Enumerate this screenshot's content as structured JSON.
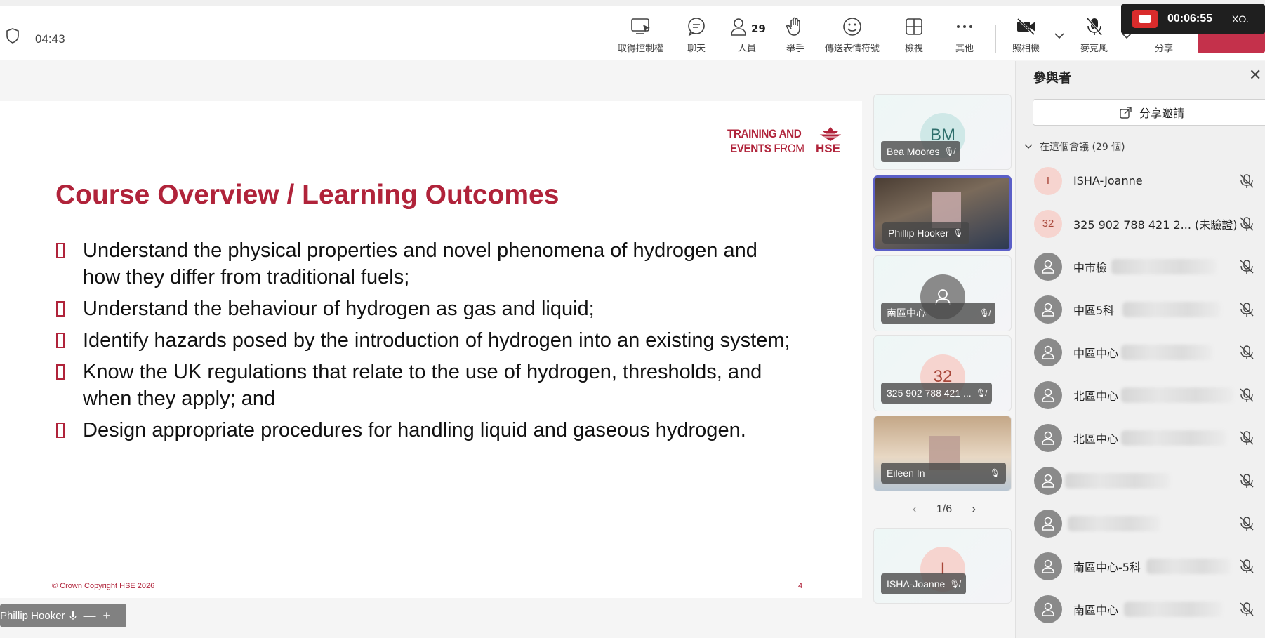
{
  "topbar": {
    "elapsed": "04:43",
    "buttons": {
      "control": "取得控制權",
      "chat": "聊天",
      "people": "人員",
      "people_count": "29",
      "raise": "舉手",
      "react": "傳送表情符號",
      "view": "檢視",
      "more": "其他",
      "camera": "照相機",
      "mic": "麥克風",
      "share": "分享"
    },
    "recording_time": "00:06:55",
    "recording_extra": "XO."
  },
  "slide": {
    "brand_line1": "TRAINING AND",
    "brand_line2_bold": "EVENTS",
    "brand_line2_light": " FROM",
    "brand_hse": "HSE",
    "title": "Course Overview / Learning Outcomes",
    "bullets": [
      "Understand the physical properties and novel phenomena of hydrogen and how they differ from traditional fuels;",
      "Understand the behaviour of hydrogen as gas and liquid;",
      "Identify hazards posed by the introduction of hydrogen into an existing system;",
      "Know the UK regulations that relate to the use of hydrogen, thresholds, and when they apply; and",
      "Design appropriate procedures for handling liquid and gaseous hydrogen."
    ],
    "copyright": "© Crown Copyright HSE 2026",
    "page": "4"
  },
  "pip": {
    "name": "Phillip Hooker"
  },
  "tiles": [
    {
      "initials": "BM",
      "name": "Bea Moores"
    },
    {
      "initials": "",
      "name": "Phillip Hooker"
    },
    {
      "initials": "",
      "name": "南區中心"
    },
    {
      "initials": "32",
      "name": "325 902 788 421 ..."
    },
    {
      "initials": "",
      "name": "Eileen In"
    },
    {
      "initials": "I",
      "name": "ISHA-Joanne"
    }
  ],
  "pager": {
    "label": "1/6"
  },
  "panel": {
    "title": "參與者",
    "share_label": "分享邀請",
    "section_label": "在這個會議 (29 個)",
    "participants": [
      {
        "initial": "I",
        "name": "ISHA-Joanne"
      },
      {
        "initial": "32",
        "name": "325 902 788 421 2... (未驗證)"
      },
      {
        "initial": "",
        "name": "中市檢"
      },
      {
        "initial": "",
        "name": "中區5科"
      },
      {
        "initial": "",
        "name": "中區中心"
      },
      {
        "initial": "",
        "name": "北區中心"
      },
      {
        "initial": "",
        "name": "北區中心"
      },
      {
        "initial": "",
        "name": ""
      },
      {
        "initial": "",
        "name": ""
      },
      {
        "initial": "",
        "name": "南區中心-5科"
      },
      {
        "initial": "",
        "name": "南區中心"
      }
    ]
  },
  "colors": {
    "accent": "#5b5fc7",
    "hse_red": "#b0233a",
    "leave": "#c4314b"
  }
}
